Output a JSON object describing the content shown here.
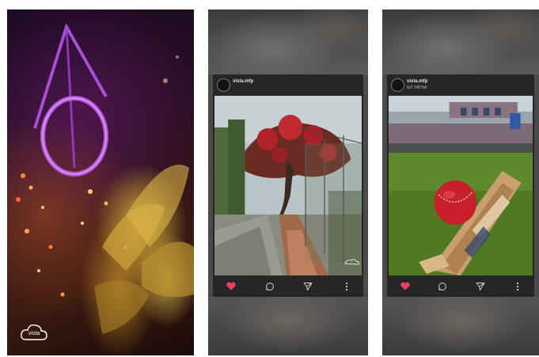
{
  "screens": [
    {
      "id": "fullscreen-photo",
      "logo_text": "vista"
    },
    {
      "id": "post-tree",
      "post": {
        "username": "vista.mfp",
        "location": "",
        "photo": "tree-walkway-photo",
        "actions": [
          "heart-icon",
          "comment-icon",
          "send-icon",
          "more-icon"
        ]
      }
    },
    {
      "id": "post-cricket",
      "post": {
        "username": "vista.mfp",
        "location": "NIT PATNA",
        "photo": "cricket-ball-bat-photo",
        "actions": [
          "heart-icon",
          "comment-icon",
          "send-icon",
          "more-icon"
        ]
      }
    }
  ],
  "colors": {
    "like": "#e8435e",
    "card_bg": "#262626",
    "icon": "#cfcfcf"
  }
}
